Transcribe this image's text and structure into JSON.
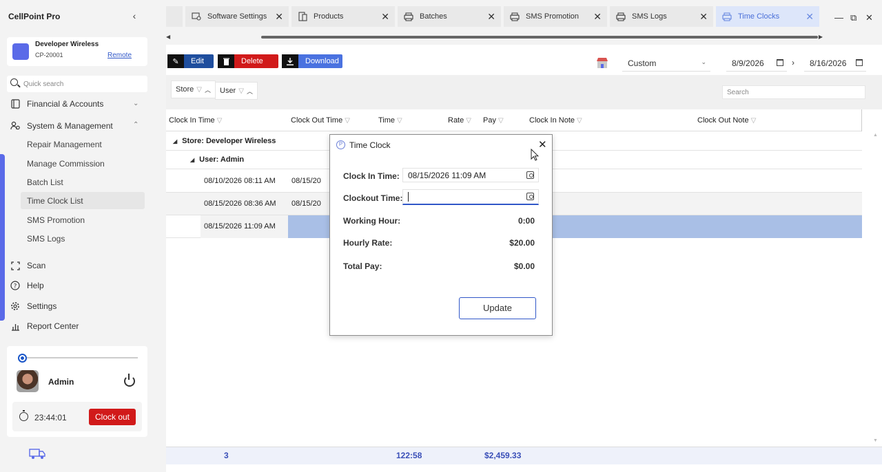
{
  "app": {
    "title": "CellPoint Pro"
  },
  "store": {
    "name": "Developer Wireless",
    "id": "CP-20001",
    "remote_label": "Remote"
  },
  "sidebar": {
    "search_placeholder": "Quick search",
    "sections": [
      {
        "label": "Financial & Accounts",
        "icon": "wallet-icon",
        "expanded": false
      },
      {
        "label": "System & Management",
        "icon": "users-icon",
        "expanded": true
      }
    ],
    "sub_items": [
      {
        "label": "Repair Management"
      },
      {
        "label": "Manage Commission"
      },
      {
        "label": "Batch List"
      },
      {
        "label": "Time Clock List",
        "active": true
      },
      {
        "label": "SMS Promotion"
      },
      {
        "label": "SMS Logs"
      }
    ],
    "bottom_items": [
      {
        "label": "Scan",
        "icon": "scan-icon"
      },
      {
        "label": "Help",
        "icon": "help-icon"
      },
      {
        "label": "Settings",
        "icon": "gear-icon"
      },
      {
        "label": "Report Center",
        "icon": "report-icon"
      }
    ]
  },
  "user": {
    "name": "Admin",
    "timer": "23:44:01",
    "clock_out_label": "Clock out"
  },
  "tabs": [
    {
      "label": "",
      "icon": ""
    },
    {
      "label": "Software Settings",
      "icon": "settings-icon"
    },
    {
      "label": "Products",
      "icon": "products-icon"
    },
    {
      "label": "Batches",
      "icon": "printer-icon"
    },
    {
      "label": "SMS Promotion",
      "icon": "printer-icon"
    },
    {
      "label": "SMS Logs",
      "icon": "printer-icon"
    },
    {
      "label": "Time Clocks",
      "icon": "printer-icon",
      "active": true
    }
  ],
  "toolbar": {
    "edit_label": "Edit",
    "delete_label": "Delete",
    "download_label": "Download"
  },
  "filter": {
    "range": "Custom",
    "date_from": "8/9/2026",
    "date_to": "8/16/2026"
  },
  "grouping": {
    "chips": [
      "Store",
      "User"
    ],
    "search_placeholder": "Search"
  },
  "grid": {
    "columns": [
      "Clock In Time",
      "Clock Out Time",
      "Time",
      "Rate",
      "Pay",
      "Clock In Note",
      "Clock Out Note"
    ],
    "group_store": "Store: Developer Wireless",
    "group_user": "User: Admin",
    "rows": [
      {
        "clock_in": "08/10/2026 08:11 AM",
        "clock_out": "08/15/20"
      },
      {
        "clock_in": "08/15/2026 08:36 AM",
        "clock_out": "08/15/20"
      },
      {
        "clock_in": "08/15/2026 11:09 AM",
        "clock_out": ""
      }
    ],
    "footer": {
      "count": "3",
      "time": "122:58",
      "pay": "$2,459.33"
    }
  },
  "dialog": {
    "title": "Time Clock",
    "clock_in_label": "Clock In Time:",
    "clock_in_value": "08/15/2026 11:09 AM",
    "clock_out_label": "Clockout Time:",
    "clock_out_value": "",
    "working_hour_label": "Working Hour:",
    "working_hour_value": "0:00",
    "hourly_rate_label": "Hourly Rate:",
    "hourly_rate_value": "$20.00",
    "total_pay_label": "Total Pay:",
    "total_pay_value": "$0.00",
    "update_label": "Update"
  }
}
